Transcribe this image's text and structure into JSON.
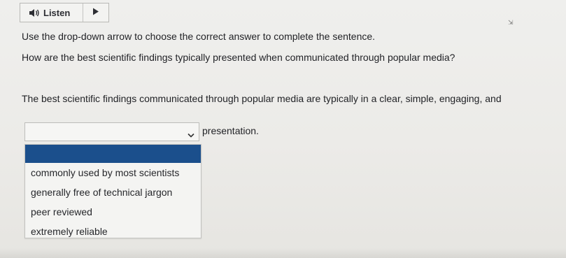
{
  "listen": {
    "label": "Listen",
    "speaker_icon": "speaker-icon",
    "play_icon": "play-icon"
  },
  "instruction": "Use the drop-down arrow to choose the correct answer to complete the sentence.",
  "question": "How are the best scientific findings typically presented when communicated through popular media?",
  "sentence": {
    "lead": "The best scientific findings communicated through popular media are typically in a clear, simple, engaging, and",
    "tail": "presentation."
  },
  "dropdown": {
    "selected": "",
    "chevron_icon": "chevron-down-icon",
    "options": [
      "commonly used by most scientists",
      "generally free of technical jargon",
      "peer reviewed",
      "extremely reliable"
    ]
  },
  "colors": {
    "highlight": "#1b4f8c",
    "background": "#efefed",
    "text": "#222327"
  }
}
